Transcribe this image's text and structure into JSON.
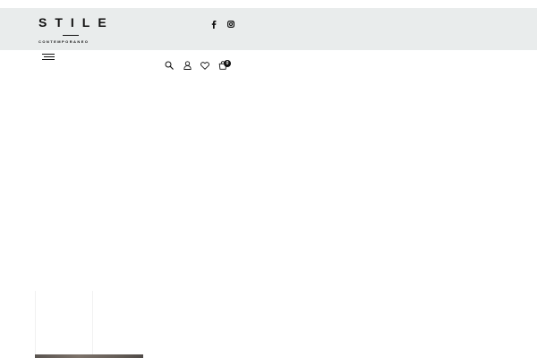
{
  "brand": {
    "name": "STILE",
    "tagline": "CONTEMPORANEO"
  },
  "social": [
    {
      "icon": "facebook-icon"
    },
    {
      "icon": "instagram-icon"
    }
  ],
  "toolbar": {
    "cart_count": "0"
  },
  "colors": {
    "topbar_bg": "#e9ecec",
    "text": "#111111",
    "page_bg": "#ffffff"
  }
}
